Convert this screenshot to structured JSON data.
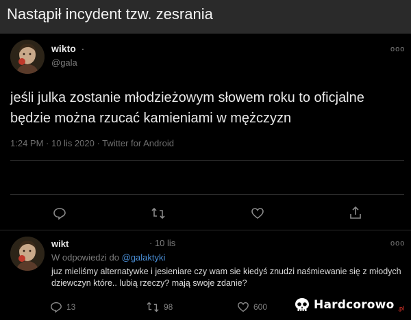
{
  "header": {
    "title": "Nastąpił incydent tzw. zesrania"
  },
  "tweet": {
    "name": "wikto",
    "name_suffix": "·",
    "handle": "@gala",
    "text": "jeśli julka zostanie młodzieżowym słowem roku to oficjalne będzie można rzucać kamieniami w mężczyzn",
    "meta": "1:24 PM · 10 lis 2020 · Twitter for Android",
    "more": "ooo",
    "actions": [
      "reply-icon",
      "retweet-icon",
      "like-icon",
      "share-icon"
    ]
  },
  "reply": {
    "name": "wikt",
    "date": "· 10 lis",
    "reply_prefix": "W odpowiedzi do",
    "reply_to": "@galaktyki",
    "text": "juz mieliśmy alternatywke i jesieniare czy wam sie kiedyś znudzi naśmiewanie się z młodych dziewczyn które.. lubią rzeczy? mają swoje zdanie?",
    "more": "ooo",
    "stats": {
      "replies": "13",
      "retweets": "98",
      "likes": "600"
    }
  },
  "watermark": {
    "text": "Hardcorowo",
    "suffix": ".pl"
  },
  "colors": {
    "background": "#000000",
    "header": "#2a2a2a",
    "link": "#4a90d9",
    "muted": "#7e7e7e"
  }
}
